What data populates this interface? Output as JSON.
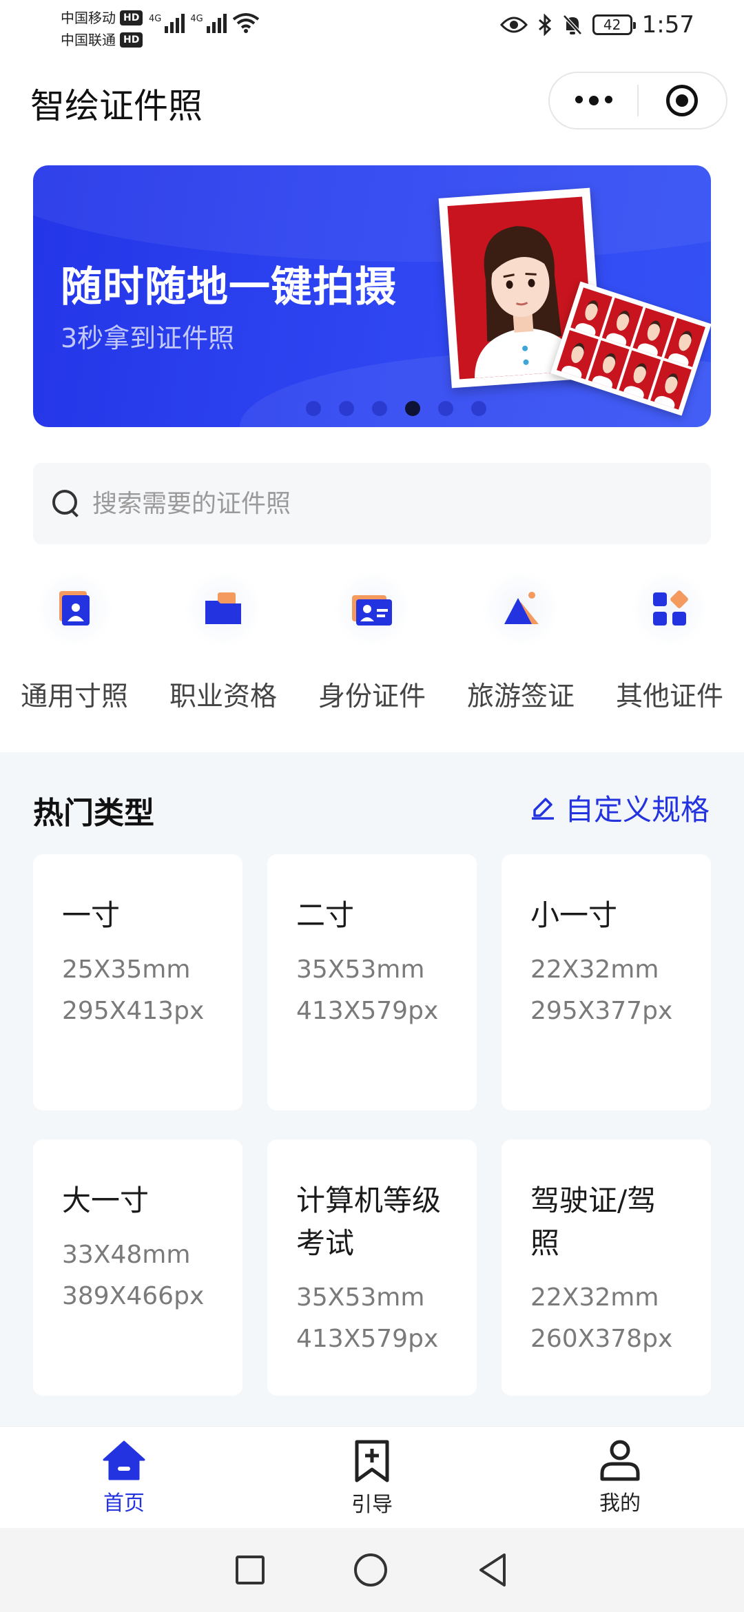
{
  "status_bar": {
    "carrier1": "中国移动",
    "carrier2": "中国联通",
    "hd": "HD",
    "net1": "4G",
    "net2": "4G",
    "battery": "42",
    "time": "1:57"
  },
  "header": {
    "title": "智绘证件照"
  },
  "banner": {
    "headline": "随时随地一键拍摄",
    "subline": "3秒拿到证件照",
    "slide_count": 6,
    "active_slide": 4
  },
  "search": {
    "placeholder": "搜索需要的证件照",
    "value": ""
  },
  "categories": [
    {
      "label": "通用寸照",
      "icon": "portrait-frame-icon"
    },
    {
      "label": "职业资格",
      "icon": "folder-icon"
    },
    {
      "label": "身份证件",
      "icon": "id-card-icon"
    },
    {
      "label": "旅游签证",
      "icon": "mountain-flag-icon"
    },
    {
      "label": "其他证件",
      "icon": "grid-apps-icon"
    }
  ],
  "hot": {
    "title": "热门类型",
    "custom_label": "自定义规格",
    "cards": [
      {
        "name": "一寸",
        "mm": "25X35mm",
        "px": "295X413px"
      },
      {
        "name": "二寸",
        "mm": "35X53mm",
        "px": "413X579px"
      },
      {
        "name": "小一寸",
        "mm": "22X32mm",
        "px": "295X377px"
      },
      {
        "name": "大一寸",
        "mm": "33X48mm",
        "px": "389X466px"
      },
      {
        "name": "计算机等级考试",
        "mm": "35X53mm",
        "px": "413X579px"
      },
      {
        "name": "驾驶证/驾照",
        "mm": "22X32mm",
        "px": "260X378px"
      }
    ]
  },
  "tabbar": {
    "home": "首页",
    "guide": "引导",
    "mine": "我的"
  },
  "colors": {
    "accent": "#2433e0",
    "banner": "#2f46f2",
    "section_bg": "#f4f7fa",
    "icon_orange": "#f59a5e"
  }
}
